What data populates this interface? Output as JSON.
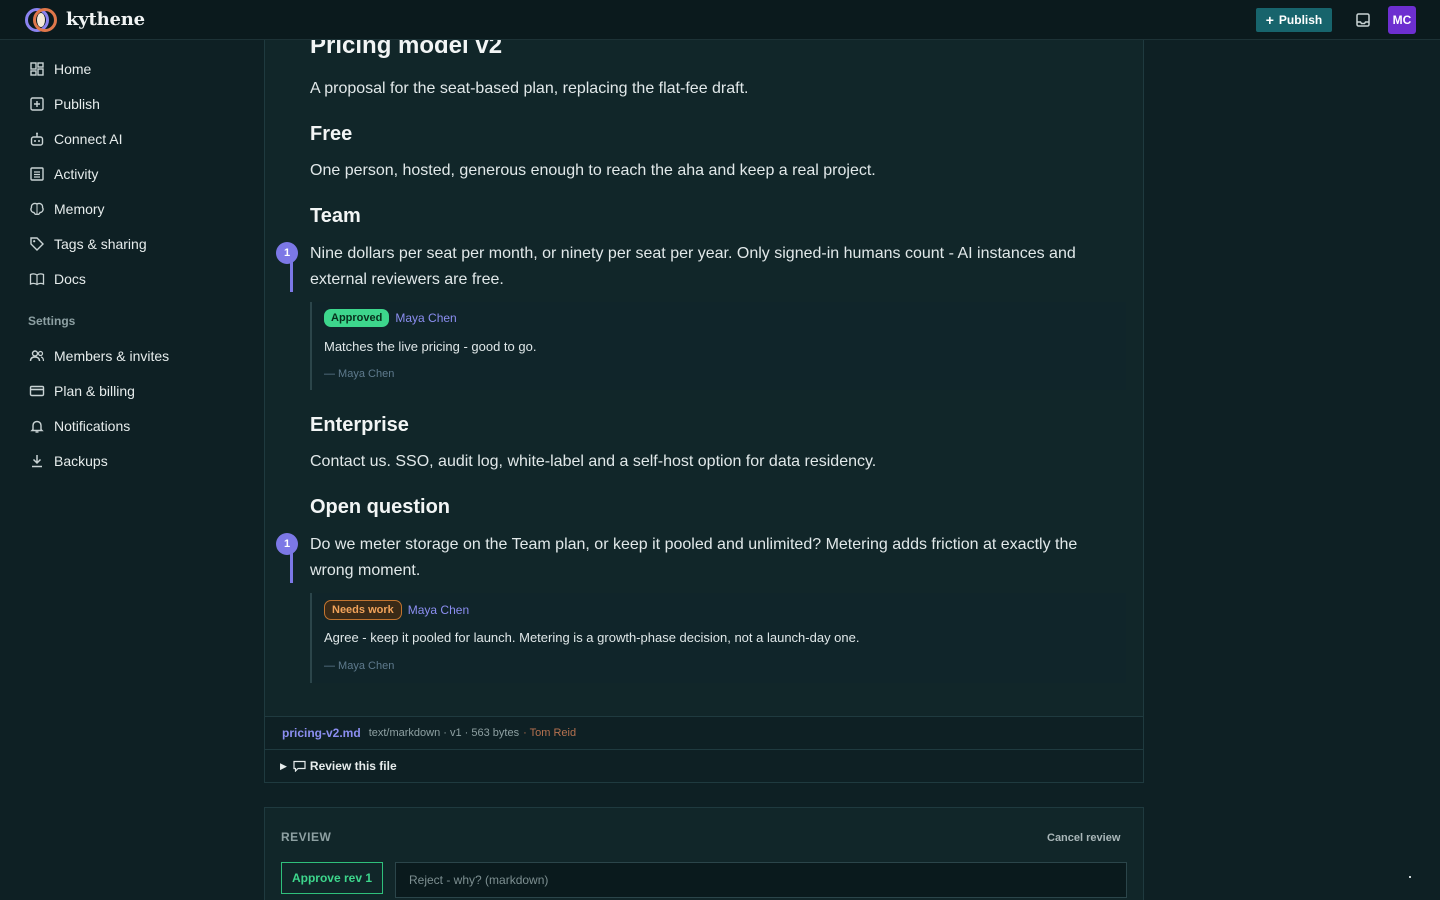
{
  "app": {
    "name": "kythene"
  },
  "header": {
    "publish_label": "Publish",
    "avatar_initials": "MC"
  },
  "sidebar": {
    "items": [
      {
        "label": "Home",
        "icon": "dashboard-icon"
      },
      {
        "label": "Publish",
        "icon": "plus-square-icon"
      },
      {
        "label": "Connect AI",
        "icon": "robot-icon"
      },
      {
        "label": "Activity",
        "icon": "list-icon"
      },
      {
        "label": "Memory",
        "icon": "brain-icon"
      },
      {
        "label": "Tags & sharing",
        "icon": "tag-icon"
      },
      {
        "label": "Docs",
        "icon": "book-icon"
      }
    ],
    "settings_heading": "Settings",
    "settings_items": [
      {
        "label": "Members & invites",
        "icon": "people-icon"
      },
      {
        "label": "Plan & billing",
        "icon": "credit-card-icon"
      },
      {
        "label": "Notifications",
        "icon": "bell-icon"
      },
      {
        "label": "Backups",
        "icon": "download-icon"
      }
    ]
  },
  "document": {
    "title": "Pricing model v2",
    "intro": "A proposal for the seat-based plan, replacing the flat-fee draft.",
    "sections": [
      {
        "heading": "Free",
        "body": "One person, hosted, generous enough to reach the aha and keep a real project."
      },
      {
        "heading": "Team",
        "body": "Nine dollars per seat per month, or ninety per seat per year. Only signed-in humans count - AI instances and external reviewers are free.",
        "comment_count": "1"
      },
      {
        "heading": "Enterprise",
        "body": "Contact us. SSO, audit log, white-label and a self-host option for data residency."
      },
      {
        "heading": "Open question",
        "body": "Do we meter storage on the Team plan, or keep it pooled and unlimited? Metering adds friction at exactly the wrong moment.",
        "comment_count": "1"
      }
    ],
    "reviews": [
      {
        "status": "Approved",
        "author": "Maya Chen",
        "text": "Matches the live pricing - good to go.",
        "signature": "— Maya Chen"
      },
      {
        "status": "Needs work",
        "author": "Maya Chen",
        "text": "Agree - keep it pooled for launch. Metering is a growth-phase decision, not a launch-day one.",
        "signature": "— Maya Chen"
      }
    ]
  },
  "file": {
    "name": "pricing-v2.md",
    "meta": "text/markdown · v1 · 563 bytes",
    "author": "· Tom Reid",
    "review_toggle_label": "Review this file"
  },
  "review_panel": {
    "title": "REVIEW",
    "cancel_label": "Cancel review",
    "approve_label": "Approve rev 1",
    "reject_placeholder": "Reject - why? (markdown)"
  },
  "colors": {
    "accent": "#7c78e6",
    "approved": "#3dd68c",
    "needs_work": "#f2a35a",
    "publish_button": "#17646c",
    "avatar": "#6d2fd0"
  }
}
